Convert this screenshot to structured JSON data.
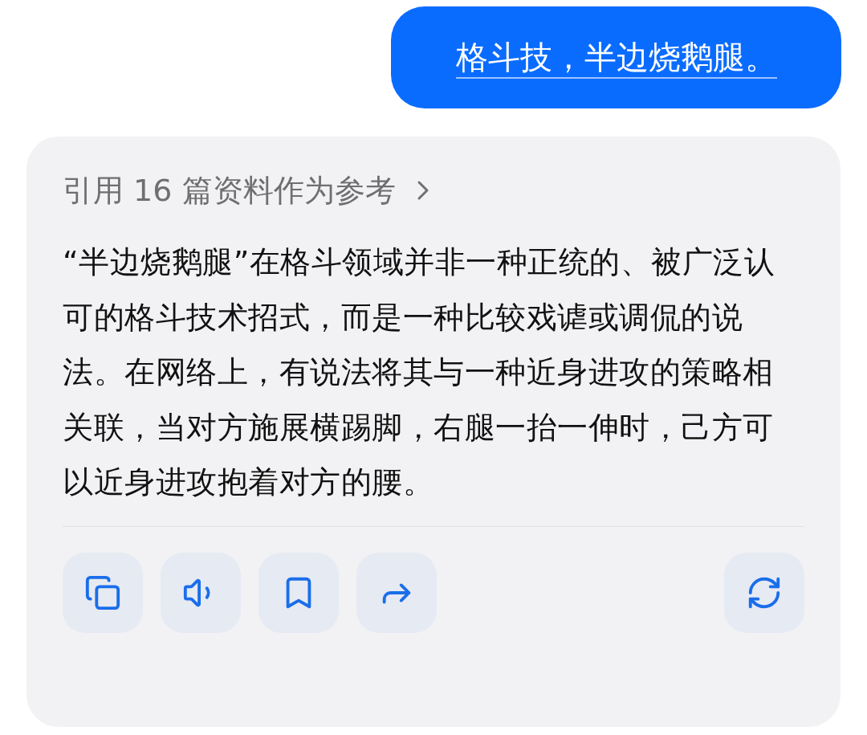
{
  "user_message": {
    "text": "格斗技，半边烧鹅腿。"
  },
  "answer": {
    "references": "引用 16 篇资料作为参考",
    "text": "“半边烧鹅腿”在格斗领域并非一种正统的、被广泛认可的格斗技术招式，而是一种比较戏谑或调侃的说法。在网络上，有说法将其与一种近身进攻的策略相关联，当对方施展横踢脚，右腿一抬一伸时，己方可以近身进攻抱着对方的腰。",
    "actions": [
      {
        "kind": "copy"
      },
      {
        "kind": "speak"
      },
      {
        "kind": "bookmark"
      },
      {
        "kind": "share"
      },
      {
        "kind": "regenerate"
      }
    ]
  }
}
